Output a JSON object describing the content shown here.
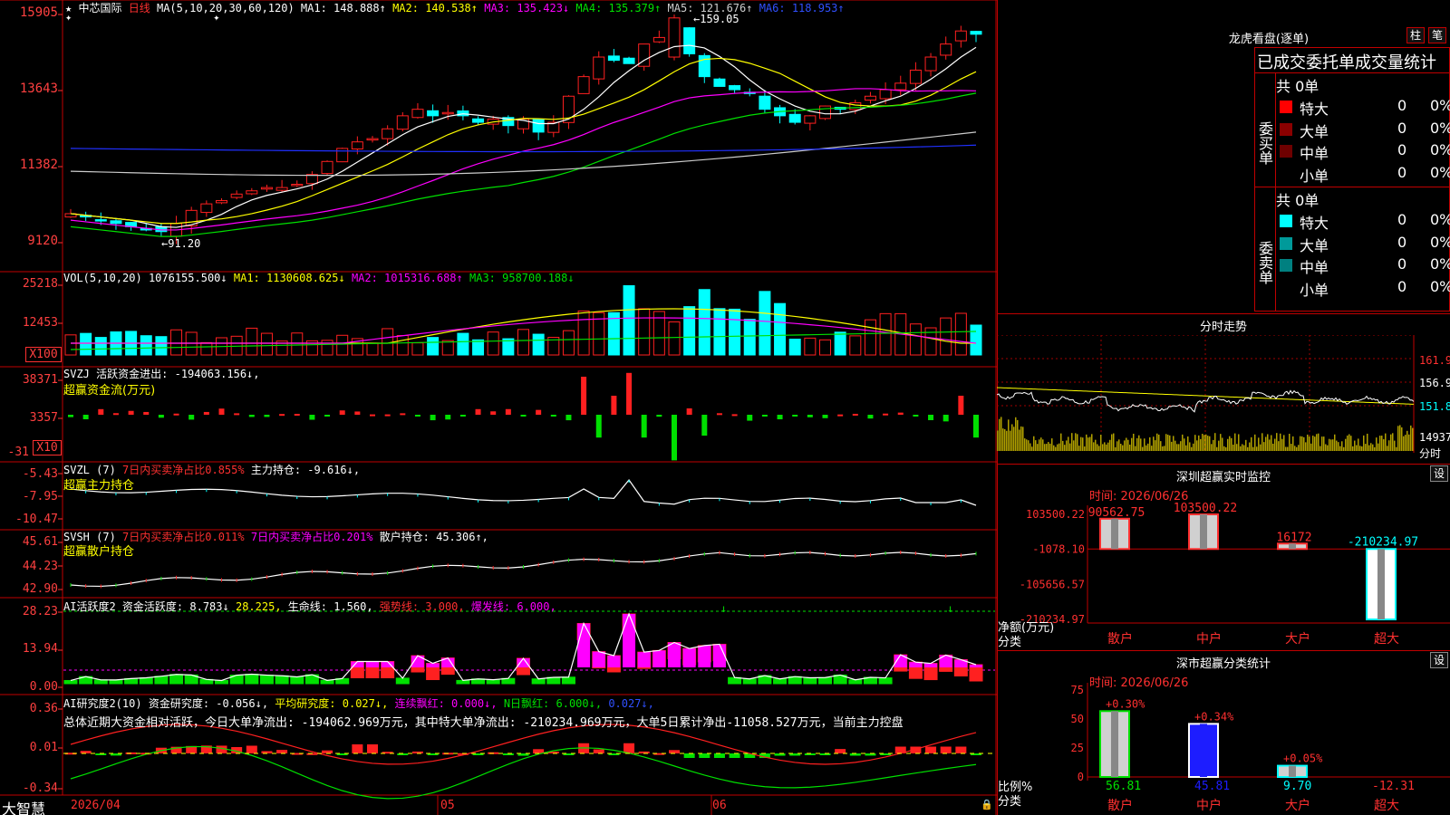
{
  "colors": {
    "up": "#ff2020",
    "down": "#00ffff",
    "green": "#00e000",
    "magenta": "#ff00ff",
    "yellow": "#ffff00",
    "white": "#ffffff",
    "blue": "#1d1dff",
    "gridred": "#a00000"
  },
  "header": {
    "stock": "中芯国际",
    "period": "日线",
    "ma_params": "MA(5,10,20,30,60,120)",
    "ma1": "MA1: 148.888↑",
    "ma2": "MA2: 140.538↑",
    "ma3": "MA3: 135.423↓",
    "ma4": "MA4: 135.379↑",
    "ma5": "MA5: 121.676↑",
    "ma6": "MA6: 118.953↑"
  },
  "price_axis": [
    "15905",
    "13643",
    "11382",
    "9120"
  ],
  "price_annotations": {
    "high": "159.05",
    "low": "91.20"
  },
  "vol": {
    "title": "VOL(5,10,20)",
    "value": "1076155.500↓",
    "ma1": "MA1: 1130608.625↓",
    "ma2": "MA2: 1015316.688↑",
    "ma3": "MA3: 958700.188↓",
    "axis": [
      "25218",
      "12453"
    ],
    "unit": "X100"
  },
  "svzj": {
    "title": "SVZJ",
    "desc": "活跃资金进出: -194063.156↓,",
    "sub": "超赢资金流(万元)",
    "axis": [
      "38371",
      "3357",
      "-31"
    ],
    "unit": "X10"
  },
  "svzl": {
    "title": "SVZL (7)",
    "p1": "7日内买卖净占比0.855%",
    "p2": "主力持仓: -9.616↓,",
    "sub": "超赢主力持仓",
    "axis": [
      "-5.43",
      "-7.95",
      "-10.47"
    ]
  },
  "svsh": {
    "title": "SVSH (7)",
    "p1": "7日内买卖净占比0.011%",
    "p2": "7日内买卖净占比0.201%",
    "p3": "散户持仓: 45.306↑,",
    "sub": "超赢散户持仓",
    "axis": [
      "45.61",
      "44.23",
      "42.90"
    ]
  },
  "ai1": {
    "title": "AI活跃度2",
    "p1": "资金活跃度: 8.783↓",
    "p2": "28.225,",
    "p3": "生命线: 1.560,",
    "p4": "强势线: 3.000,",
    "p5": "爆发线: 6.000,",
    "axis": [
      "28.23",
      "13.94",
      "0.00"
    ]
  },
  "ai2": {
    "title": "AI研究度2(10)",
    "p1": "资金研究度: -0.056↓,",
    "p2": "平均研究度: 0.027↓,",
    "p3": "连续飘红: 0.000↓,",
    "p4": "N日飘红: 6.000↓,",
    "p5": "0.027↓,",
    "note": "总体近期大资金相对活跃，今日大单净流出: -194062.969万元，其中特大单净流出: -210234.969万元，大单5日累计净出-11058.527万元，当前主力控盘",
    "axis": [
      "0.36",
      "0.01",
      "-0.34"
    ]
  },
  "dates": {
    "d1": "2026/04",
    "d2": "05",
    "d3": "06"
  },
  "brand": "大智慧",
  "lhb": {
    "title": "龙虎看盘(逐单)",
    "btn1": "柱",
    "btn2": "笔",
    "header": "已成交委托单成交量统计",
    "buy_total": "共 0单",
    "sell_total": "共 0单",
    "buy_label": "委买单",
    "sell_label": "委卖单",
    "buy_rows": [
      {
        "name": "特大",
        "v": "0",
        "p": "0%",
        "c": "#ff0000"
      },
      {
        "name": "大单",
        "v": "0",
        "p": "0%",
        "c": "#8b0000"
      },
      {
        "name": "中单",
        "v": "0",
        "p": "0%",
        "c": "#6e0000"
      },
      {
        "name": "小单",
        "v": "0",
        "p": "0%",
        "c": "#000000"
      }
    ],
    "sell_rows": [
      {
        "name": "特大",
        "v": "0",
        "p": "0%",
        "c": "#00ffff"
      },
      {
        "name": "大单",
        "v": "0",
        "p": "0%",
        "c": "#009a9a"
      },
      {
        "name": "中单",
        "v": "0",
        "p": "0%",
        "c": "#008080"
      },
      {
        "name": "小单",
        "v": "0",
        "p": "0%",
        "c": "#000000"
      }
    ]
  },
  "intraday": {
    "title": "分时走势",
    "axis": [
      "161.9",
      "156.9",
      "151.8"
    ],
    "vol_label": "14937",
    "unit": "分时"
  },
  "sz_monitor": {
    "title": "深圳超赢实时监控",
    "set": "设",
    "time": "时间: 2026/06/26",
    "axis": [
      "103500.22",
      "-1078.10",
      "-105656.57",
      "-210234.97"
    ],
    "ylabel": "净额(万元)",
    "xlabel": "分类",
    "cats": [
      "散户",
      "中户",
      "大户",
      "超大"
    ],
    "values": [
      90562.75,
      103500.22,
      16172,
      -210234.97
    ],
    "value_labels": [
      "90562.75",
      "103500.22",
      "16172",
      "-210234.97"
    ]
  },
  "sz_class": {
    "title": "深市超赢分类统计",
    "set": "设",
    "time": "时间: 2026/06/26",
    "axis": [
      "75",
      "50",
      "25",
      "0"
    ],
    "ylabel": "比例%",
    "xlabel": "分类",
    "cats": [
      "散户",
      "中户",
      "大户",
      "超大"
    ],
    "top": [
      "+0.30%",
      "+0.34%",
      "+0.05%",
      ""
    ],
    "bottom": [
      "56.81",
      "45.81",
      "9.70",
      "-12.31"
    ],
    "values": [
      56.81,
      45.81,
      9.7,
      -12.31
    ]
  }
}
